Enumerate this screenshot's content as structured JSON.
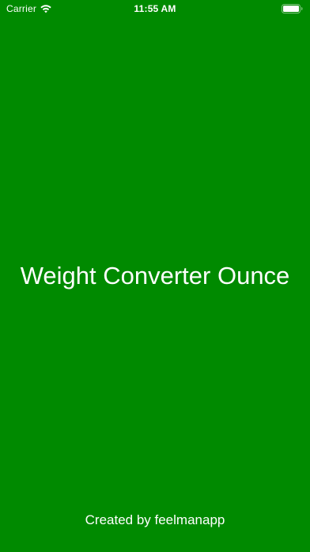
{
  "status_bar": {
    "carrier": "Carrier",
    "time": "11:55 AM",
    "wifi_icon": "wifi-icon",
    "battery_icon": "battery-icon"
  },
  "splash": {
    "title": "Weight Converter Ounce",
    "credit": "Created by feelmanapp"
  },
  "colors": {
    "background": "#008a00",
    "text": "#ffffff"
  }
}
